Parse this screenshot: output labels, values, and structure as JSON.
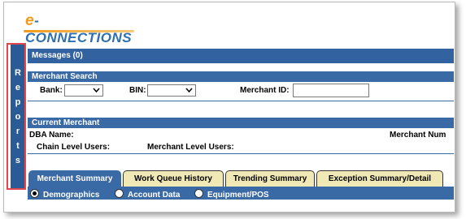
{
  "brand": {
    "logo_e": "e",
    "logo_rest": "-CONNECTIONS"
  },
  "sidebar": {
    "reports_letters": [
      "R",
      "e",
      "p",
      "o",
      "r",
      "t",
      "s"
    ]
  },
  "messages": {
    "label": "Messages (0)"
  },
  "merchant_search": {
    "title": "Merchant Search",
    "bank_label": "Bank:",
    "bin_label": "BIN:",
    "merchant_id_label": "Merchant ID:",
    "merchant_id_value": ""
  },
  "current_merchant": {
    "title": "Current Merchant",
    "dba_label": "DBA Name:",
    "merchant_num_label": "Merchant Num",
    "chain_users_label": "Chain Level Users:",
    "merchant_users_label": "Merchant Level Users:"
  },
  "tabs": [
    {
      "label": "Merchant Summary",
      "active": true
    },
    {
      "label": "Work Queue History",
      "active": false
    },
    {
      "label": "Trending Summary",
      "active": false
    },
    {
      "label": "Exception Summary/Detail",
      "active": false
    }
  ],
  "view_options": [
    {
      "label": "Demographics",
      "selected": true
    },
    {
      "label": "Account Data",
      "selected": false
    },
    {
      "label": "Equipment/POS",
      "selected": false
    }
  ],
  "colors": {
    "bar_blue": "#3a6aa6",
    "tab_inactive": "#f0e9b6",
    "logo_orange": "#f29a1b",
    "logo_blue": "#2f6fb0",
    "highlight_red": "#e0474c"
  }
}
